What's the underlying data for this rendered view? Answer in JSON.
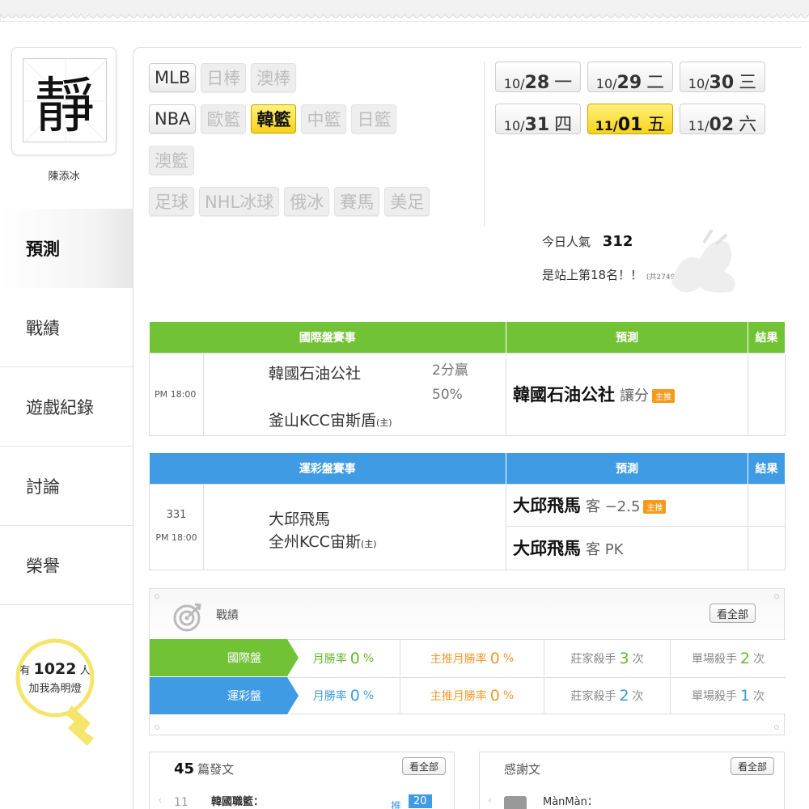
{
  "user": {
    "avatar_glyph": "靜",
    "name": "陳添冰"
  },
  "nav": {
    "items": [
      {
        "label": "預測",
        "active": true
      },
      {
        "label": "戰績",
        "active": false
      },
      {
        "label": "遊戲紀錄",
        "active": false
      },
      {
        "label": "討論",
        "active": false
      },
      {
        "label": "榮譽",
        "active": false
      }
    ]
  },
  "fans": {
    "prefix": "有",
    "count": "1022",
    "suffix": "人",
    "line2": "加我為明燈"
  },
  "leagues": {
    "row1": [
      {
        "label": "MLB",
        "state": "normal"
      },
      {
        "label": "日棒",
        "state": "disabled"
      },
      {
        "label": "澳棒",
        "state": "disabled"
      }
    ],
    "row2": [
      {
        "label": "NBA",
        "state": "normal"
      },
      {
        "label": "歐籃",
        "state": "disabled"
      },
      {
        "label": "韓籃",
        "state": "active"
      },
      {
        "label": "中籃",
        "state": "disabled"
      },
      {
        "label": "日籃",
        "state": "disabled"
      }
    ],
    "row3": [
      {
        "label": "澳籃",
        "state": "disabled"
      }
    ],
    "row4": [
      {
        "label": "足球",
        "state": "disabled"
      },
      {
        "label": "NHL冰球",
        "state": "disabled"
      },
      {
        "label": "俄冰",
        "state": "disabled"
      },
      {
        "label": "賽馬",
        "state": "disabled"
      },
      {
        "label": "美足",
        "state": "disabled"
      }
    ]
  },
  "dates": {
    "row1": [
      {
        "month": "10/",
        "day": "28",
        "weekday": "一",
        "active": false
      },
      {
        "month": "10/",
        "day": "29",
        "weekday": "二",
        "active": false
      },
      {
        "month": "10/",
        "day": "30",
        "weekday": "三",
        "active": false
      }
    ],
    "row2": [
      {
        "month": "10/",
        "day": "31",
        "weekday": "四",
        "active": false
      },
      {
        "month": "11/",
        "day": "01",
        "weekday": "五",
        "active": true
      },
      {
        "month": "11/",
        "day": "02",
        "weekday": "六",
        "active": false
      }
    ]
  },
  "popularity": {
    "label": "今日人氣",
    "value": "312",
    "rank_text": "是站上第18名！！",
    "total": "(共2749人)"
  },
  "intl_table": {
    "headers": [
      "國際盤賽事",
      "預測",
      "結果"
    ],
    "time": "PM 18:00",
    "team1": "韓國石油公社",
    "team2": "釜山KCC宙斯盾",
    "home_mark": "(主)",
    "handicap1": "2分贏",
    "handicap2": "50%",
    "prediction": "韓國石油公社",
    "prediction_sub": "讓分",
    "badge": "主推"
  },
  "lottery_table": {
    "headers": [
      "運彩盤賽事",
      "預測",
      "結果"
    ],
    "game_no": "331",
    "time": "PM 18:00",
    "team1": "大邱飛馬",
    "team2": "全州KCC宙斯",
    "home_mark": "(主)",
    "pred1": "大邱飛馬",
    "pred1_sub": "客 −2.5",
    "pred2": "大邱飛馬",
    "pred2_sub": "客 PK",
    "badge": "主推"
  },
  "record": {
    "title": "戰績",
    "see_all": "看全部",
    "rows": [
      {
        "label": "國際盤",
        "month_rate_label": "月勝率",
        "month_rate": "0",
        "main_rate_label": "主推月勝率",
        "main_rate": "0",
        "unit": "%",
        "dealer_label": "莊家殺手",
        "dealer": "3",
        "single_label": "單場殺手",
        "single": "2",
        "times_unit": "次"
      },
      {
        "label": "運彩盤",
        "month_rate_label": "月勝率",
        "month_rate": "0",
        "main_rate_label": "主推月勝率",
        "main_rate": "0",
        "unit": "%",
        "dealer_label": "莊家殺手",
        "dealer": "2",
        "single_label": "單場殺手",
        "single": "1",
        "times_unit": "次"
      }
    ]
  },
  "posts": {
    "count": "45",
    "label": "篇發文",
    "see_all": "看全部",
    "first_item_num": "11",
    "first_item_title": "韓國職籃：",
    "push_label": "推",
    "push_count": "20"
  },
  "thanks": {
    "label": "感謝文",
    "see_all": "看全部",
    "first_item_user": "MànMàn："
  },
  "colors": {
    "green": "#72c236",
    "blue": "#3f9be3",
    "orange": "#f29a2e",
    "active_yellow": "#f7d21a"
  }
}
